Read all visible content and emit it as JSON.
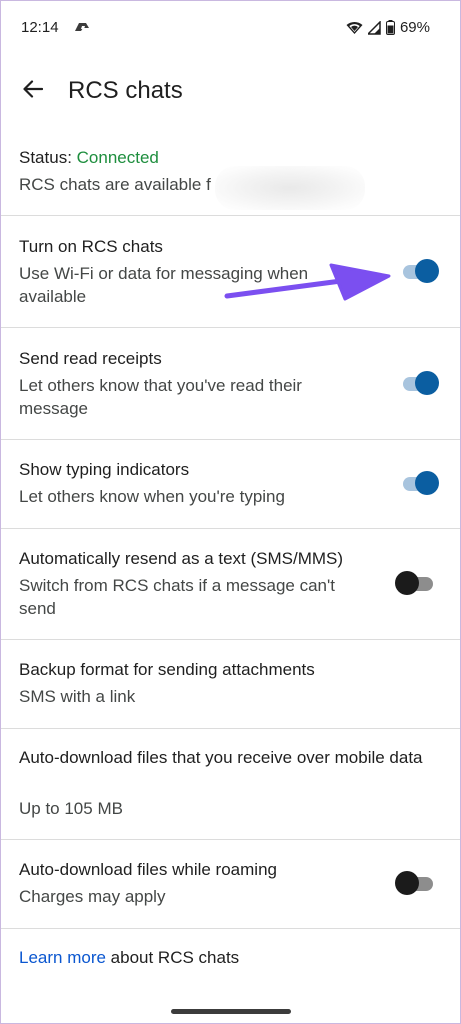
{
  "status_bar": {
    "time": "12:14",
    "battery": "69%"
  },
  "app_bar": {
    "title": "RCS chats"
  },
  "status": {
    "label": "Status:",
    "value": "Connected",
    "description": "RCS chats are available f"
  },
  "settings": [
    {
      "title": "Turn on RCS chats",
      "subtitle": "Use Wi-Fi or data for messaging when available",
      "toggle": "on"
    },
    {
      "title": "Send read receipts",
      "subtitle": "Let others know that you've read their message",
      "toggle": "on"
    },
    {
      "title": "Show typing indicators",
      "subtitle": "Let others know when you're typing",
      "toggle": "on"
    },
    {
      "title": "Automatically resend as a text (SMS/MMS)",
      "subtitle": "Switch from RCS chats if a message can't send",
      "toggle": "off"
    },
    {
      "title": "Backup format for sending attachments",
      "subtitle": "SMS with a link"
    },
    {
      "title": "Auto-download files that you receive over mobile data",
      "subtitle": "Up to 105 MB"
    },
    {
      "title": "Auto-download files while roaming",
      "subtitle": "Charges may apply",
      "toggle": "off"
    }
  ],
  "footer": {
    "link_text": "Learn more",
    "rest_text": " about RCS chats"
  },
  "colors": {
    "connected_green": "#1e8e3e",
    "switch_on_thumb": "#0b5ea1",
    "switch_on_track": "#a8c4de",
    "switch_off_thumb": "#1b1b1b",
    "link_blue": "#0b57d0",
    "annotation_arrow": "#7b4ff0"
  }
}
